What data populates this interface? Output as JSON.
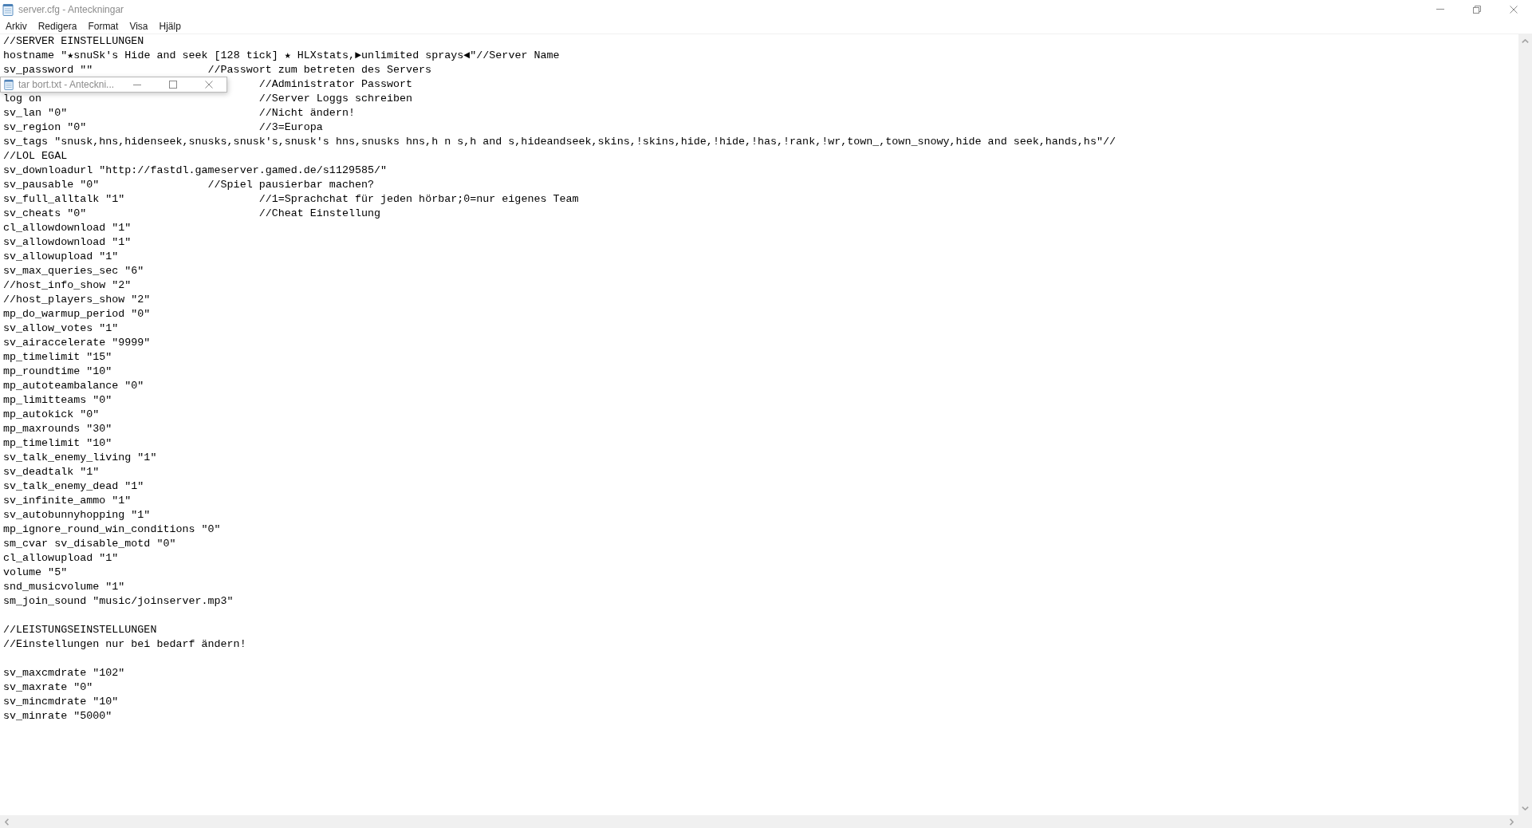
{
  "window": {
    "title": "server.cfg - Anteckningar"
  },
  "menu": [
    "Arkiv",
    "Redigera",
    "Format",
    "Visa",
    "Hjälp"
  ],
  "editor": {
    "blocks": [
      [
        "//SERVER EINSTELLUNGEN",
        "hostname \"★snuSk's Hide and seek [128 tick] ★ HLXstats,►unlimited sprays◄\"//Server Name",
        "sv_password \"\"\t\t\t//Passwort zum betreten des Servers",
        "\t\t\t\t\t//Administrator Passwort",
        "log on\t\t\t\t\t//Server Loggs schreiben",
        "sv_lan \"0\"\t\t\t\t//Nicht ändern!",
        "sv_region \"0\"\t\t\t\t//3=Europa",
        "sv_tags \"snusk,hns,hidenseek,snusks,snusk's,snusk's hns,snusks hns,h n s,h and s,hideandseek,skins,!skins,hide,!hide,!has,!rank,!wr,town_,town_snowy,hide and seek,hands,hs\"//",
        "//LOL EGAL",
        "sv_downloadurl \"http://fastdl.gameserver.gamed.de/s1129585/\"",
        "sv_pausable \"0\"\t\t\t//Spiel pausierbar machen?",
        "sv_full_alltalk \"1\"\t\t\t//1=Sprachchat für jeden hörbar;0=nur eigenes Team",
        "sv_cheats \"0\"\t\t\t\t//Cheat Einstellung",
        "cl_allowdownload \"1\"",
        "sv_allowdownload \"1\"",
        "sv_allowupload \"1\"",
        "sv_max_queries_sec \"6\"",
        "//host_info_show \"2\"",
        "//host_players_show \"2\"",
        "mp_do_warmup_period \"0\"",
        "sv_allow_votes \"1\"",
        "sv_airaccelerate \"9999\"",
        "mp_timelimit \"15\"",
        "mp_roundtime \"10\"",
        "mp_autoteambalance \"0\"",
        "mp_limitteams \"0\"",
        "mp_autokick \"0\"",
        "mp_maxrounds \"30\"",
        "mp_timelimit \"10\"",
        "sv_talk_enemy_living \"1\"",
        "sv_deadtalk \"1\"",
        "sv_talk_enemy_dead \"1\"",
        "sv_infinite_ammo \"1\"",
        "sv_autobunnyhopping \"1\"",
        "mp_ignore_round_win_conditions \"0\"",
        "sm_cvar sv_disable_motd \"0\"",
        "cl_allowupload \"1\"",
        "volume \"5\"",
        "snd_musicvolume \"1\"",
        "sm_join_sound \"music/joinserver.mp3\""
      ],
      [
        "//LEISTUNGSEINSTELLUNGEN",
        "//Einstellungen nur bei bedarf ändern!"
      ],
      [
        "sv_maxcmdrate \"102\"",
        "sv_maxrate \"0\"",
        "sv_mincmdrate \"10\"",
        "sv_minrate \"5000\""
      ]
    ]
  },
  "overlay_window": {
    "title": "tar bort.txt - Anteckni..."
  }
}
